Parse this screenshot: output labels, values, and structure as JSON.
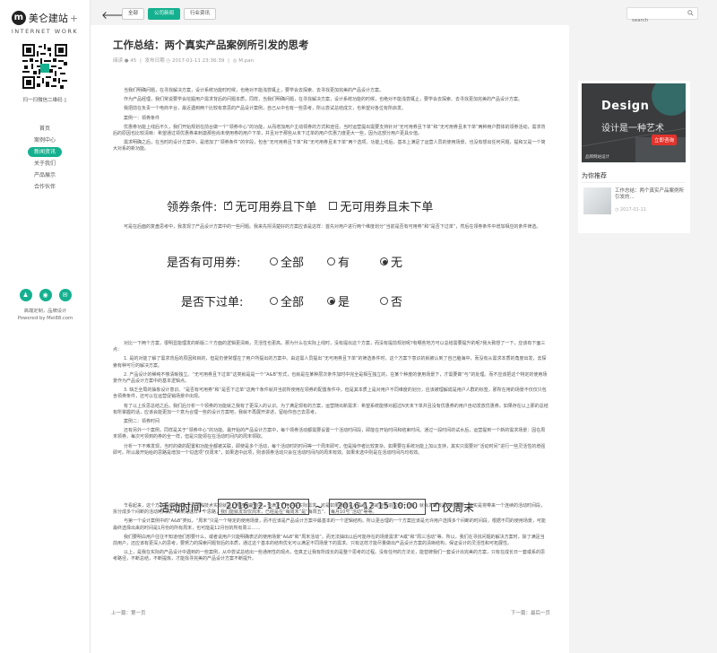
{
  "sidebar": {
    "logo_letter": "m",
    "logo_text": "美仑建站",
    "logo_plus": "+",
    "logo_sub": "INTERNET WORK",
    "qr_caption": "扫一扫微信二维码",
    "nav": [
      {
        "label": "首页"
      },
      {
        "label": "案例中心"
      },
      {
        "label": "新闻资讯",
        "active": true
      },
      {
        "label": "关于我们"
      },
      {
        "label": "产品展示"
      },
      {
        "label": "合作伙伴"
      }
    ],
    "footer_line1": "高端定制，品牌设计",
    "footer_line2": "Powered by Mei88.com"
  },
  "topbar": {
    "tabs": [
      {
        "label": "全部",
        "active": false
      },
      {
        "label": "公司新闻",
        "active": true
      },
      {
        "label": "行业资讯",
        "active": false
      }
    ],
    "search_placeholder": "search"
  },
  "article": {
    "title": "工作总结：两个真实产品案例所引发的思考",
    "meta_views": "阅读 ● 45",
    "meta_sep": "|",
    "meta_date": "发布日期 ◷ 2017-01-11 23:36:39",
    "meta_author": "◎ M.pan",
    "para_a": [
      "当我们明确问题，在寻找解决方案，设计系统功能时时候，也绝对不能浅尝辄止，要学会去探索、去寻找更加完美的产品设计方案。",
      "作为产品经理，我们常说要学会挖掘用户需求背后的问题本质，同样，当我们明确问题，在寻找解决方案，设计系统功能的时候，也绝对不能浅尝辄止，要学会去探索、去寻找更加完美的产品设计方案。",
      "我把前在负责一个电商平台，最近遇到两个比较有意思的产品设计案例，自己从中也有一些思考，所以尝试总结成文，也希望对各位有所启发。",
      "案例一：领券条件",
      "优惠券功能上线后不久，我们开始规划在前台做一个“领券中心”的功能，从而增加用户主动领券的方式和途径。当时运营提出需要支持针对“无可用券且下单”和“无可用券且未下单”两种用户群体的领券活动，需求背后的原因也比较清晰：希望通过领优惠券来刺激那些尚未使用券的用户下单，并且对于那些从未下过单的用户优惠力度更大一些，因为这部分用户更具价值。",
      "需求明确之后，在当时的设计方案中，是增加了“领券条件”的字段，包含“无可用券且下单”和“无可用券且未下单”两个选项。功能上线后，基本上满足了运营人员的使用场景，也没有想出任何问题，提和又是一个简大对系的新功能。"
    ],
    "fig1": {
      "label": "领券条件:",
      "opt1": "无可用券且下单",
      "opt2": "无可用券且未下单"
    },
    "para_b": [
      "可是在后面的复盘思考中，我发现了产品设计方案中的一些问题。我来先捋清楚好的方案应该是这样：首先对用户进行两个维度划分“当前是否有可用券”和“是否下过单”，然后在领券条件中增加相应的条件筛选。"
    ],
    "fig2": {
      "label1": "是否有可用券:",
      "label2": "是否下过单:",
      "opt_all": "全部",
      "opt_yes": "有",
      "opt_no": "无",
      "opt_yes2": "是",
      "opt_no2": "否"
    },
    "para_c": [
      "对比一下两个方案，很明显能理发的新版二个方面的逻辑更清晰，灵活性也更高。那为什么在实际上线时，没有提出这个方案，而没有提前规划呢?有哪些地方可以总结需要提升的呢?我大致想了一下，应该有下面三点：",
      "1. 是的对能了解了需求背后的原因和目的，但是仍使常理在了用户所提出的方案中。由这需人员提出“无可用券且下单”的筛选条件时，这个方案下意识的就被认到了自己脑海中，而没有从需求本质的角度出发，去探索有种可行的解决方案。",
      "2. 产品设计的稀纯不够清晰独立。“无可用券且下过单”这类就是是一个“A&B”形式，也就是在某种层次条件加时中完全是相互独立的，在某个种度的使用场景下，才需要做“与”的处理。而不应该把这个特定的使用场景作为产品设计方案中的基本逻辑点。",
      "3. 缺乏全局的抽象设计意识。“是否有可用券”和“是否下过单”这两个条件就并当前所使用在领券的配置条件中，但是其本质上是对用户不同维度的划分，应该被理解成是用户人群的标签，那所在用的场景不仅仅只包含领券条件，还可以在运营促销场景中出现。",
      "有了以上反思总结之后，我们后分析一个领券的功能就之我有了更深入的认识。为了满足现有的方案，运营随出新需求：希望系统能够对超过N天未下单并且没有优惠券的用户自动发放优惠券。如果存在以上那的总结有所掌握的话，应该会能更加一个意为合理一些的设计方案吧，我就不再展开讲述，留给你自己去思考。",
      "案例二：领券时间",
      "还有另外一个案例，同样是关于“领券中心”的功能。最开始的产品设计方案中，每个领券活动都需要设置一个活动时间段，即能在开始时间和结束时间。通过一段时间的试水后，运营提到一个新的需求场景：因在周末领券，每次可领到的券的全一样，但是只能领在在活动时间内的周末领取。",
      "分析一下不难发现，当时的做的配置和功能全都被关联，即使是多个活动，每个活动时的时间等一个周末即可，但是操作者比较复杂。如果要在系统功能上加以支持，其实只需要对“活动时间”进行一些灵活性的增强即可。所以最开始给的思路是增加一个勾选项“仅周末”，如果选中此项，则该领券活动只会在活动时间内的周末有效。如果未选中则是在活动时间内均有效。"
    ],
    "fig3": {
      "label": "活动时间:",
      "start": "2016-12-1 10:00",
      "tilde": "~",
      "end": "2016-12-15 10:00",
      "weekend": "仅周末"
    },
    "para_d": [
      "乍看起来，这个方案完全是按找灵活地和技术实现就是上那还我能做事，也满足了用户的实际需求，可是如果细细深入思考，将可能会造成进行分析，就会发现该需求的本质，其实是将带来一个连续的活动时间段，拆分成多个间断的活动时间段。如果是这样一个思路，我们能就发现仅周末，已经是在“每周末”是“每周五”、“每月10号”活动”等等。",
      "与第一个设计案例中的“A&B”类似，“周末”只是一个特定的使用场景，而不应该是产品设计方案中最基本的一个逻辑结构。所以更合理的一个方案应该是允许用户选择多个间断的时间段，根据不同的使用场景，可能最终选择出来的时间是1月份的所有周末，也可能是12月份的所有周三……",
      "我们要明白用户往往不知道他们想要什么，或者说用户只能明确表达的使用场景“A&B”和“周末活动”。而无法抽出以后可能存在的场景需求“A或”和“周三活动”等。所以，我们在寻找问题的解决方案时，除了满足当前用户，还应该有更深入的思考，要努力的探索问题背后的本质，通过这个基本的结构优化可以满足不同场景下的需求。只有这样才能尽量做出产品设计方案的清晰结构，保证设计的灵活性和可拓展性。",
      "以上，是我在实际的产品设计中遇到的一些案例，从中尝试总结出一些通用性的观点，但真正让我有所成长的是整个思考的过程。没有任何的方法论，能替牌我们一套设计出完美的方案，只有在成长日一套或系的思考路径，不断总结，不断提炼，才能找寻完美的产品设计方案不断提升。"
    ],
    "prev": "上一篇：第一页",
    "next": "下一篇：最后一页"
  },
  "right_panel": {
    "banner_line1": "Design",
    "banner_line2": "设计是一种艺术",
    "banner_cta": "立即咨询",
    "banner_small": "品牌网站设计",
    "rec_title": "为你推荐",
    "rec_item_text": "工作总结：两个真实产品案例所引发的...",
    "rec_item_date": "◷ 2017-01-11"
  }
}
